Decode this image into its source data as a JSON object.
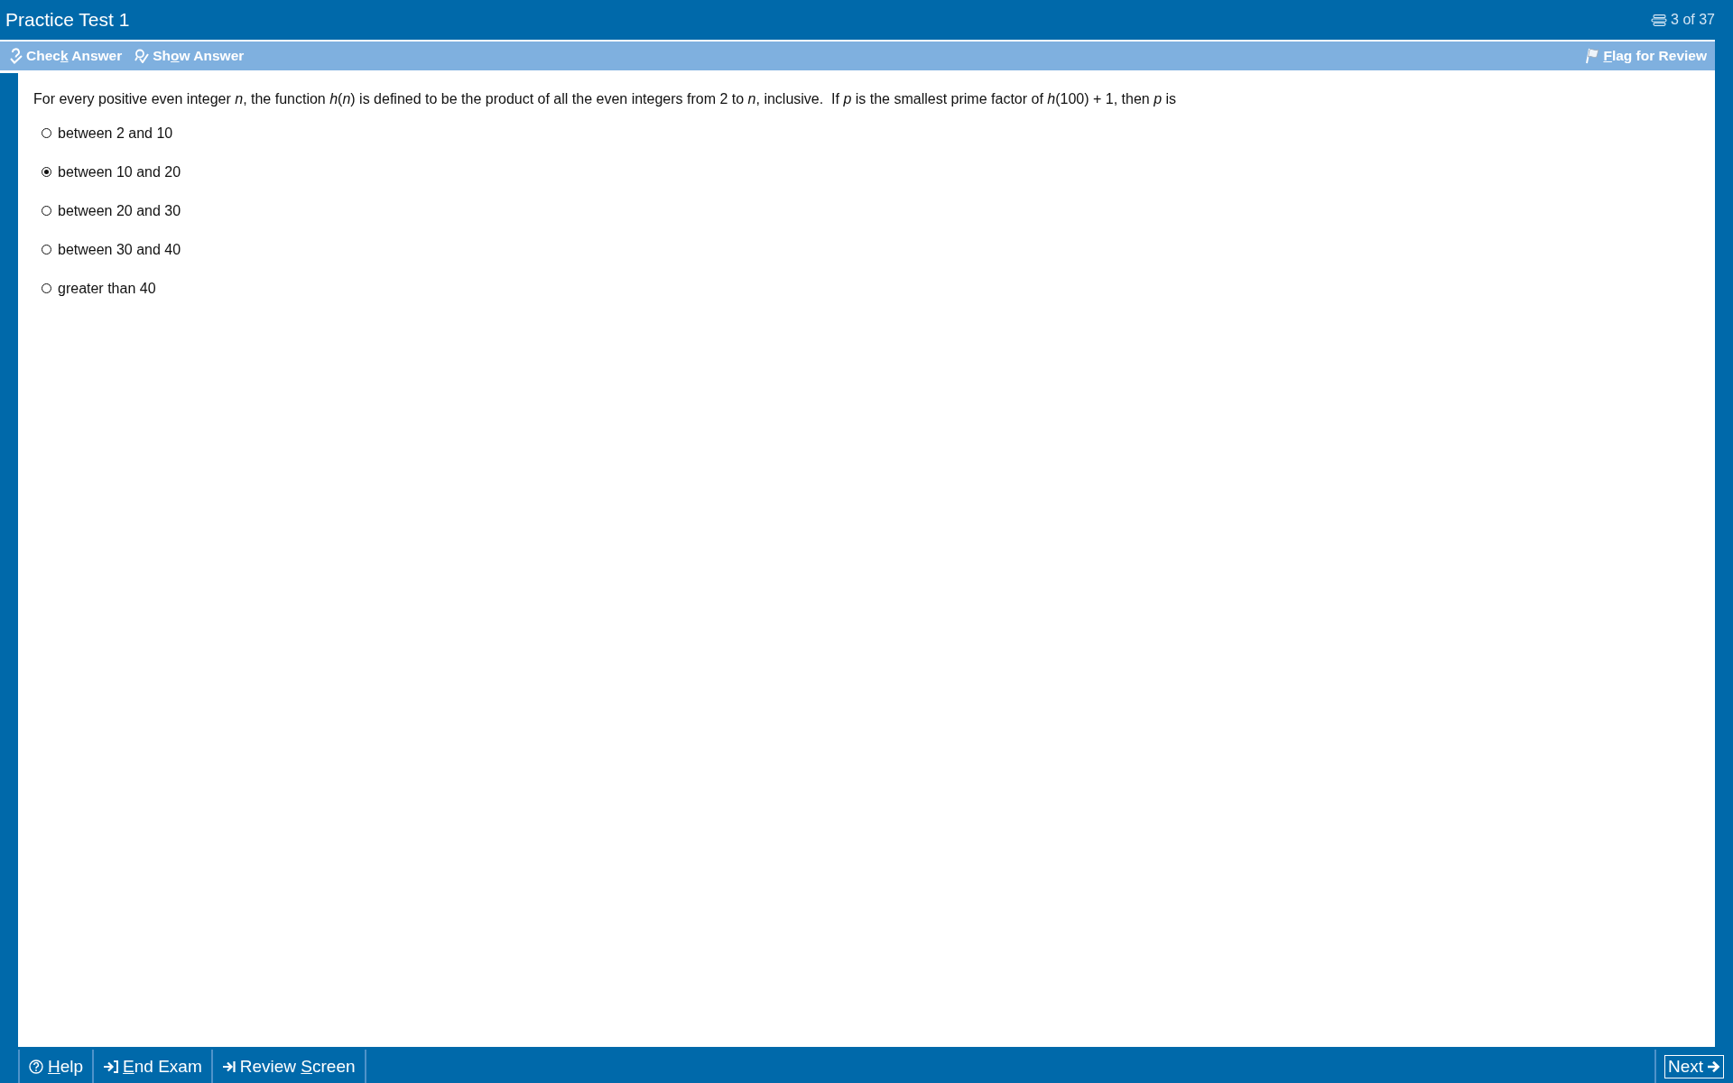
{
  "window": {
    "title": "Practice Test 1",
    "progress": "3 of 37"
  },
  "toolbar": {
    "left": [
      {
        "kind": "check",
        "text_before": "Chec",
        "hotkey": "k",
        "text_after": " Answer"
      },
      {
        "kind": "show",
        "text_before": "Sh",
        "hotkey": "o",
        "text_after": "w Answer"
      }
    ],
    "right": [
      {
        "kind": "flag",
        "hotkey": "F",
        "text_after": "lag for Review"
      }
    ]
  },
  "question": {
    "stem": "For every positive even integer *n*, the function *h*(*n*) is defined to be the product of all the even integers from 2 to *n*, inclusive.  If *p* is the smallest prime factor of *h*(100) + 1, then *p* is",
    "options": [
      {
        "label": "between 2 and 10",
        "selected": false
      },
      {
        "label": "between 10 and 20",
        "selected": true
      },
      {
        "label": "between 20 and 30",
        "selected": false
      },
      {
        "label": "between 30 and 40",
        "selected": false
      },
      {
        "label": "greater than 40",
        "selected": false
      }
    ]
  },
  "footer": {
    "buttons": [
      {
        "kind": "help",
        "hotkey": "H",
        "text_after": "elp"
      },
      {
        "kind": "end",
        "hotkey": "E",
        "text_after": "nd Exam"
      },
      {
        "kind": "review",
        "text_before": "Review ",
        "hotkey": "S",
        "text_after": "creen"
      }
    ],
    "next": {
      "label": "Next",
      "focused": true
    }
  }
}
